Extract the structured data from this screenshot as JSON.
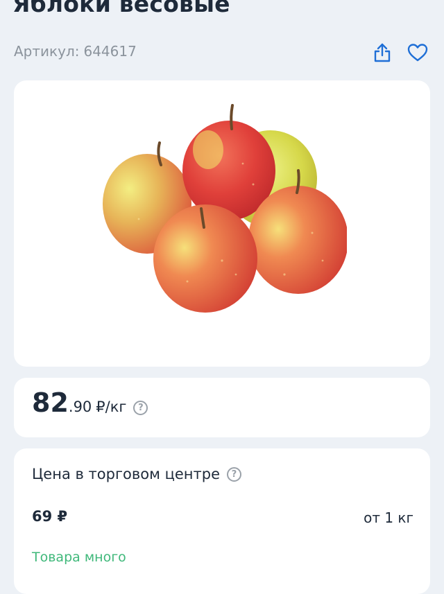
{
  "product": {
    "title": "Яблоки весовые",
    "sku_label": "Артикул:",
    "sku_value": "644617"
  },
  "actions": {
    "share_icon": "share-icon",
    "favorite_icon": "heart-icon"
  },
  "price": {
    "whole": "82",
    "fraction": ".90",
    "unit": "₽/кг",
    "help": "?"
  },
  "store": {
    "title": "Цена в торговом центре",
    "help": "?",
    "price": "69 ₽",
    "min_quantity": "от 1 кг",
    "stock_status": "Товара много"
  },
  "colors": {
    "background": "#edf1f6",
    "card": "#ffffff",
    "accent_blue": "#1f6fd6",
    "stock_green": "#3fb87a",
    "muted_text": "#8b939c"
  }
}
